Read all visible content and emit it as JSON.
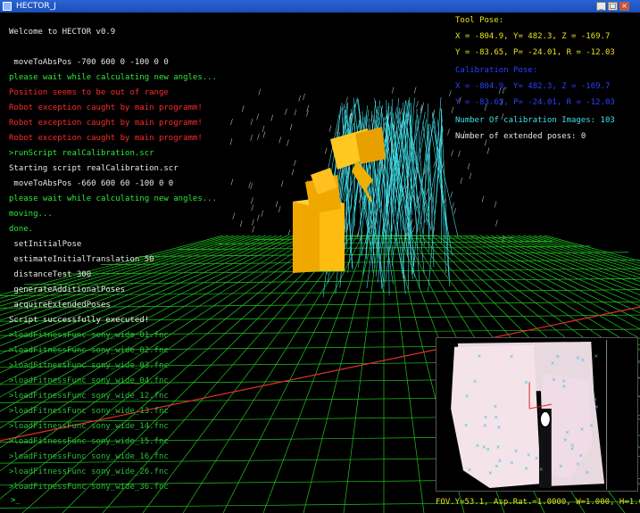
{
  "window": {
    "title": "HECTOR_J"
  },
  "console": {
    "lines": [
      {
        "text": "Welcome to HECTOR v0.9",
        "color": "white"
      },
      {
        "text": "",
        "color": "white"
      },
      {
        "text": " moveToAbsPos -700 600 0 -100 0 0",
        "color": "white"
      },
      {
        "text": "please wait while calculating new angles...",
        "color": "green"
      },
      {
        "text": "Position seems to be out of range",
        "color": "red"
      },
      {
        "text": "Robot exception caught by main programm!",
        "color": "red"
      },
      {
        "text": "Robot exception caught by main programm!",
        "color": "red"
      },
      {
        "text": "Robot exception caught by main programm!",
        "color": "red"
      },
      {
        "text": ">runScript realCalibration.scr",
        "color": "green"
      },
      {
        "text": "Starting script realCalibration.scr",
        "color": "white"
      },
      {
        "text": " moveToAbsPos -660 600 60 -100 0 0",
        "color": "white"
      },
      {
        "text": "please wait while calculating new angles...",
        "color": "green"
      },
      {
        "text": "moving...",
        "color": "green"
      },
      {
        "text": "done.",
        "color": "green"
      },
      {
        "text": " setInitialPose",
        "color": "white"
      },
      {
        "text": " estimateInitialTranslation 50",
        "color": "white"
      },
      {
        "text": " distanceTest 300",
        "color": "white"
      },
      {
        "text": " generateAdditionalPoses",
        "color": "white"
      },
      {
        "text": " acquireExtendedPoses",
        "color": "white"
      },
      {
        "text": "Script successfully executed!",
        "color": "white"
      },
      {
        "text": ">loadFitnessFunc sony_wide_01.fnc",
        "color": "dgreen"
      },
      {
        "text": ">loadFitnessFunc sony_wide_02.fnc",
        "color": "dgreen"
      },
      {
        "text": ">loadFitnessFunc sony_wide_03.fnc",
        "color": "dgreen"
      },
      {
        "text": ">loadFitnessFunc sony_wide_04.fnc",
        "color": "dgreen"
      },
      {
        "text": ">loadFitnessFunc sony_wide_12.fnc",
        "color": "dgreen"
      },
      {
        "text": ">loadFitnessFunc sony_wide_13.fnc",
        "color": "dgreen"
      },
      {
        "text": ">loadFitnessFunc sony_wide_14.fnc",
        "color": "dgreen"
      },
      {
        "text": ">loadFitnessFunc sony_wide_15.fnc",
        "color": "dgreen"
      },
      {
        "text": ">loadFitnessFunc sony_wide_16.fnc",
        "color": "dgreen"
      },
      {
        "text": ">loadFitnessFunc sony_wide_26.fnc",
        "color": "dgreen"
      },
      {
        "text": ">loadFitnessFunc sony_wide_36.fnc",
        "color": "dgreen"
      }
    ],
    "prompt": ">_"
  },
  "pose": {
    "header": "Tool Pose:",
    "line1": "X = -804.9, Y= 482.3, Z = -169.7",
    "line2": "Y = -83.65, P= -24.01, R = -12.03",
    "calib_header": "Calibration Pose:",
    "calib_line1": "X = -804.9, Y= 482.3, Z = -169.7",
    "calib_line2": "Y = -83.65, P= -24.01, R = -12.03",
    "num_images": "Number Of calibration Images: 103",
    "num_extended": "Number of extended poses: 0"
  },
  "fov_text": "FOV.Y=53.1, Asp.Rat.=1.0000, W=1.000, H=1.000",
  "colors": {
    "white": "#e8e8e8",
    "green": "#2ee83a",
    "red": "#ff2a2a",
    "dgreen": "#2ac03a",
    "cyan": "#40e0e8",
    "blue": "#2a40ff",
    "yellow": "#e8e020",
    "grid": "#1fc81f",
    "robot": "#f0b000"
  }
}
